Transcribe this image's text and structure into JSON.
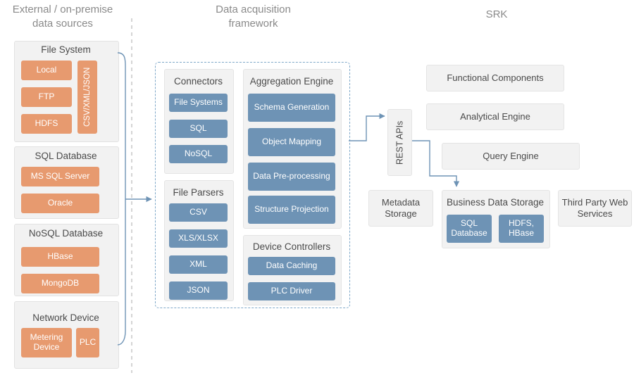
{
  "columns": {
    "left_title": "External / on-premise\ndata sources",
    "left_title_line1": "External / on-premise",
    "left_title_line2": "data sources",
    "mid_title_line1": "Data acquisition",
    "mid_title_line2": "framework",
    "right_title": "SRK"
  },
  "sources": {
    "file_system": {
      "label": "File System",
      "items": [
        "Local",
        "FTP",
        "HDFS"
      ],
      "format_tag": "CSV/XML/JSON"
    },
    "sql_database": {
      "label": "SQL Database",
      "items": [
        "MS SQL Server",
        "Oracle"
      ]
    },
    "nosql_database": {
      "label": "NoSQL Database",
      "items": [
        "HBase",
        "MongoDB"
      ]
    },
    "network_device": {
      "label": "Network Device",
      "items": [
        "Metering Device",
        "PLC"
      ]
    }
  },
  "framework": {
    "connectors": {
      "title": "Connectors",
      "items": [
        "File Systems",
        "SQL",
        "NoSQL"
      ]
    },
    "file_parsers": {
      "title": "File Parsers",
      "items": [
        "CSV",
        "XLS/XLSX",
        "XML",
        "JSON"
      ]
    },
    "aggregation_engine": {
      "title": "Aggregation Engine",
      "items": [
        "Schema Generation",
        "Object Mapping",
        "Data Pre-processing",
        "Structure Projection"
      ]
    },
    "device_controllers": {
      "title": "Device Controllers",
      "items": [
        "Data Caching",
        "PLC Driver"
      ]
    }
  },
  "srk": {
    "rest_apis": "REST APIs",
    "functional_components": "Functional Components",
    "analytical_engine": "Analytical Engine",
    "query_engine": "Query Engine",
    "metadata_storage": "Metadata Storage",
    "business_data_storage": {
      "title": "Business Data Storage",
      "items": [
        "SQL Database",
        "HDFS, HBase"
      ]
    },
    "third_party": "Third Party Web Services"
  },
  "colors": {
    "orange": "#e79a6f",
    "blue": "#6e93b5",
    "panel": "#f2f2f2",
    "title_grey": "#8a8a8a",
    "arrow": "#6e93b5"
  }
}
